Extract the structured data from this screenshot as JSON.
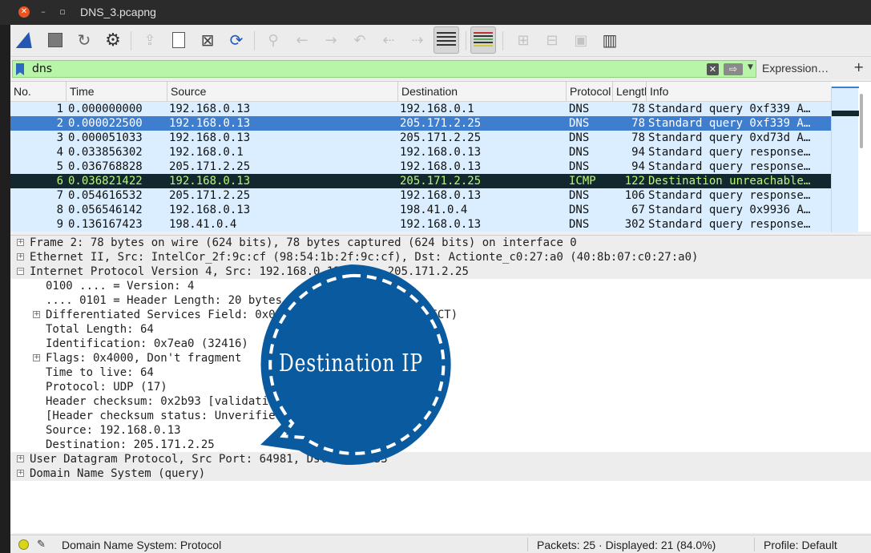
{
  "window": {
    "title": "DNS_3.pcapng"
  },
  "toolbar": {
    "buttons": [
      {
        "icon": "shark-fin-icon"
      },
      {
        "icon": "stop-icon"
      },
      {
        "icon": "restart-icon"
      },
      {
        "icon": "options-gear-icon"
      },
      {
        "icon": "open-file-icon"
      },
      {
        "icon": "save-file-icon"
      },
      {
        "icon": "close-file-icon"
      },
      {
        "icon": "reload-icon"
      },
      {
        "icon": "find-icon"
      },
      {
        "icon": "back-icon"
      },
      {
        "icon": "forward-icon"
      },
      {
        "icon": "goto-icon"
      },
      {
        "icon": "first-icon"
      },
      {
        "icon": "last-icon"
      },
      {
        "icon": "autoscroll-icon"
      },
      {
        "icon": "colorize-icon"
      },
      {
        "icon": "zoom-in-icon"
      },
      {
        "icon": "zoom-out-icon"
      },
      {
        "icon": "normal-size-icon"
      },
      {
        "icon": "resize-columns-icon"
      }
    ]
  },
  "filter": {
    "value": "dns",
    "expression_label": "Expression…",
    "add_label": "+",
    "apply_label": "⇨",
    "clear_label": "✕",
    "field_color": "#b8f5a8"
  },
  "packet_list": {
    "columns": [
      "No.",
      "Time",
      "Source",
      "Destination",
      "Protocol",
      "Length",
      "Info"
    ],
    "rows": [
      {
        "no": "1",
        "time": "0.000000000",
        "source": "192.168.0.13",
        "destination": "192.168.0.1",
        "protocol": "DNS",
        "length": "78",
        "info": "Standard query 0xf339 A…"
      },
      {
        "no": "2",
        "time": "0.000022500",
        "source": "192.168.0.13",
        "destination": "205.171.2.25",
        "protocol": "DNS",
        "length": "78",
        "info": "Standard query 0xf339 A…"
      },
      {
        "no": "3",
        "time": "0.000051033",
        "source": "192.168.0.13",
        "destination": "205.171.2.25",
        "protocol": "DNS",
        "length": "78",
        "info": "Standard query 0xd73d A…"
      },
      {
        "no": "4",
        "time": "0.033856302",
        "source": "192.168.0.1",
        "destination": "192.168.0.13",
        "protocol": "DNS",
        "length": "94",
        "info": "Standard query response…"
      },
      {
        "no": "5",
        "time": "0.036768828",
        "source": "205.171.2.25",
        "destination": "192.168.0.13",
        "protocol": "DNS",
        "length": "94",
        "info": "Standard query response…"
      },
      {
        "no": "6",
        "time": "0.036821422",
        "source": "192.168.0.13",
        "destination": "205.171.2.25",
        "protocol": "ICMP",
        "length": "122",
        "info": "Destination unreachable…"
      },
      {
        "no": "7",
        "time": "0.054616532",
        "source": "205.171.2.25",
        "destination": "192.168.0.13",
        "protocol": "DNS",
        "length": "106",
        "info": "Standard query response…"
      },
      {
        "no": "8",
        "time": "0.056546142",
        "source": "192.168.0.13",
        "destination": "198.41.0.4",
        "protocol": "DNS",
        "length": "67",
        "info": "Standard query 0x9936 A…"
      },
      {
        "no": "9",
        "time": "0.136167423",
        "source": "198.41.0.4",
        "destination": "192.168.0.13",
        "protocol": "DNS",
        "length": "302",
        "info": "Standard query response…"
      }
    ],
    "selected_row": 2,
    "colors": {
      "dns": "#daeeff",
      "selected": "#3f7ecf",
      "icmp_bg": "#12272e",
      "icmp_fg": "#b7f774"
    }
  },
  "details": {
    "lines": [
      {
        "text": "Frame 2: 78 bytes on wire (624 bits), 78 bytes captured (624 bits) on interface 0",
        "expander": "+"
      },
      {
        "text": "Ethernet II, Src: IntelCor_2f:9c:cf (98:54:1b:2f:9c:cf), Dst: Actionte_c0:27:a0 (40:8b:07:c0:27:a0)",
        "expander": "+"
      },
      {
        "text": "Internet Protocol Version 4, Src: 192.168.0.13, Dst: 205.171.2.25",
        "expander": "−"
      },
      {
        "text": "0100 .... = Version: 4",
        "expander": ""
      },
      {
        "text": ".... 0101 = Header Length: 20 bytes (5)",
        "expander": ""
      },
      {
        "text": "Differentiated Services Field: 0x00 (DSCP: CS0, ECN: Not-ECT)",
        "expander": "+"
      },
      {
        "text": "Total Length: 64",
        "expander": ""
      },
      {
        "text": "Identification: 0x7ea0 (32416)",
        "expander": ""
      },
      {
        "text": "Flags: 0x4000, Don't fragment",
        "expander": "+"
      },
      {
        "text": "Time to live: 64",
        "expander": ""
      },
      {
        "text": "Protocol: UDP (17)",
        "expander": ""
      },
      {
        "text": "Header checksum: 0x2b93 [validation disabled]",
        "expander": ""
      },
      {
        "text": "[Header checksum status: Unverified]",
        "expander": ""
      },
      {
        "text": "Source: 192.168.0.13",
        "expander": ""
      },
      {
        "text": "Destination: 205.171.2.25",
        "expander": ""
      },
      {
        "text": "User Datagram Protocol, Src Port: 64981, Dst Port: 53",
        "expander": "+"
      },
      {
        "text": "Domain Name System (query)",
        "expander": "+"
      }
    ]
  },
  "overlay": {
    "label": "Destination IP",
    "color": "#0a5aa0"
  },
  "status": {
    "field_info": "Domain Name System: Protocol",
    "packets": "Packets: 25 · Displayed: 21 (84.0%)",
    "profile": "Profile: Default"
  }
}
